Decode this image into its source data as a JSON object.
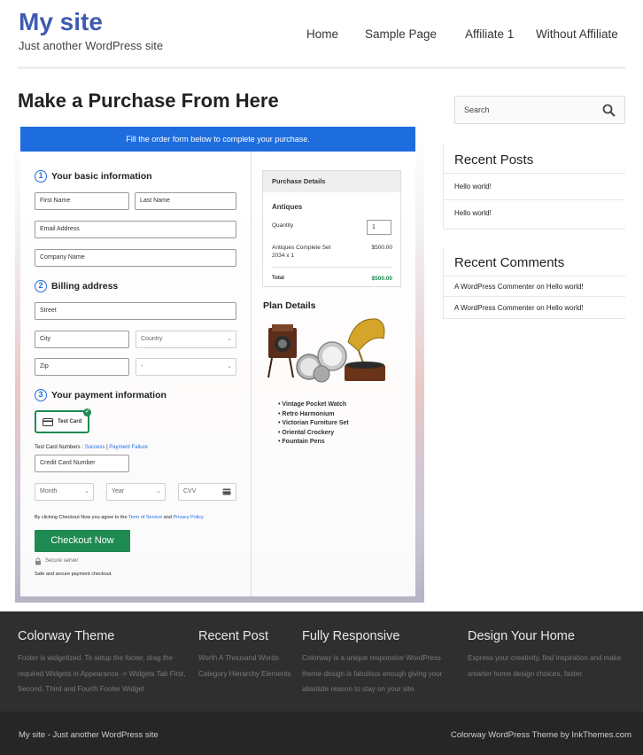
{
  "header": {
    "site_title": "My site",
    "tagline": "Just another WordPress site",
    "nav": [
      "Home",
      "Sample Page",
      "Affiliate 1",
      "Without Affiliate"
    ]
  },
  "page": {
    "title": "Make a Purchase From Here"
  },
  "form": {
    "banner": "Fill the order form below to complete your purchase.",
    "step1": {
      "num": "1",
      "title": "Your basic information"
    },
    "step2": {
      "num": "2",
      "title": "Billing address"
    },
    "step3": {
      "num": "3",
      "title": "Your payment information"
    },
    "placeholders": {
      "first_name": "First Name",
      "last_name": "Last Name",
      "email": "Email Address",
      "company": "Company Name",
      "street": "Street",
      "city": "City",
      "zip": "Zip",
      "card_number": "Credit Card Number",
      "cvv": "CVV"
    },
    "selects": {
      "country": "Country",
      "state": "-",
      "month": "Month",
      "year": "Year"
    },
    "test_card_label": "Test Card",
    "test_numbers_label": "Test Card Numbers :",
    "success_link": "Success",
    "separator": "|",
    "failure_link": "Payment Failure",
    "terms_prefix": "By clicking Checkout Now you agree to the",
    "terms_link": "Term of Service",
    "terms_and": "and",
    "privacy_link": "Privacy Policy",
    "checkout_button": "Checkout Now",
    "secure_server": "Secure server",
    "secure_note": "Safe and secure payment checkout."
  },
  "purchase_details": {
    "heading": "Purchase Details",
    "product": "Antiques",
    "quantity_label": "Quantity",
    "quantity_value": "1",
    "item_line1": "Antiques Complete Set",
    "item_line2": "2034 x 1",
    "item_price": "$500.00",
    "total_label": "Total",
    "total_value": "$500.00"
  },
  "plan": {
    "title": "Plan Details",
    "items": [
      "Vintage Pocket Watch",
      "Retro Harmonium",
      "Victorian Furniture Set",
      "Oriental Crockery",
      "Fountain Pens"
    ]
  },
  "sidebar": {
    "search_placeholder": "Search",
    "recent_posts_title": "Recent Posts",
    "recent_posts": [
      "Hello world!",
      "Hello world!"
    ],
    "recent_comments_title": "Recent Comments",
    "recent_comments": [
      {
        "author": "A WordPress Commenter",
        "on": "on",
        "post": "Hello world!"
      },
      {
        "author": "A WordPress Commenter",
        "on": "on",
        "post": "Hello world!"
      }
    ]
  },
  "footer": {
    "cols": [
      {
        "title": "Colorway Theme",
        "text": "Footer is widgetized. To setup the footer, drag the required Widgets in Appearance -> Widgets Tab First, Second, Third and Fourth Footer Widget"
      },
      {
        "title": "Recent Post",
        "text": "Worth A Thousand Words Category Hierarchy Elements"
      },
      {
        "title": "Fully Responsive",
        "text": "Colorway is a unique responsive WordPress theme design is fabulous enough giving your absolute reason to stay on your site."
      },
      {
        "title": "Design Your Home",
        "text": "Express your creativity, find inspiration and make smarter home design choices, faster."
      }
    ],
    "bottom_left": "My site - Just another WordPress site",
    "bottom_right": "Colorway WordPress Theme by InkThemes.com"
  },
  "colors": {
    "brand": "#3f5bb0",
    "accent": "#1e6ddf",
    "success": "#1f8a52",
    "footer": "#2f2f2f"
  }
}
